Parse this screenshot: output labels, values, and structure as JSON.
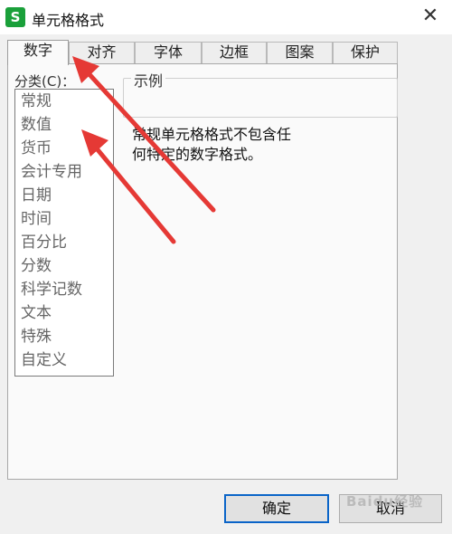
{
  "window": {
    "icon_glyph": "S",
    "title": "单元格格式",
    "close_glyph": "✕"
  },
  "tabs": [
    {
      "label": "数字",
      "active": true
    },
    {
      "label": "对齐"
    },
    {
      "label": "字体"
    },
    {
      "label": "边框"
    },
    {
      "label": "图案"
    },
    {
      "label": "保护"
    }
  ],
  "category": {
    "label": "分类(C)：",
    "items": [
      "常规",
      "数值",
      "货币",
      "会计专用",
      "日期",
      "时间",
      "百分比",
      "分数",
      "科学记数",
      "文本",
      "特殊",
      "自定义"
    ]
  },
  "sample": {
    "legend": "示例",
    "value": ""
  },
  "description": {
    "line1": "常规单元格格式不包含任",
    "line2": "何特定的数字格式。"
  },
  "buttons": {
    "ok": "确定",
    "cancel": "取消"
  },
  "watermark": "Baidu经验",
  "colors": {
    "accent": "#0a64c8",
    "annotation_arrow": "#e53935",
    "app_icon": "#1aa03a"
  },
  "icons": [
    "wps-spreadsheet-icon",
    "close-icon",
    "annotation-arrow"
  ]
}
